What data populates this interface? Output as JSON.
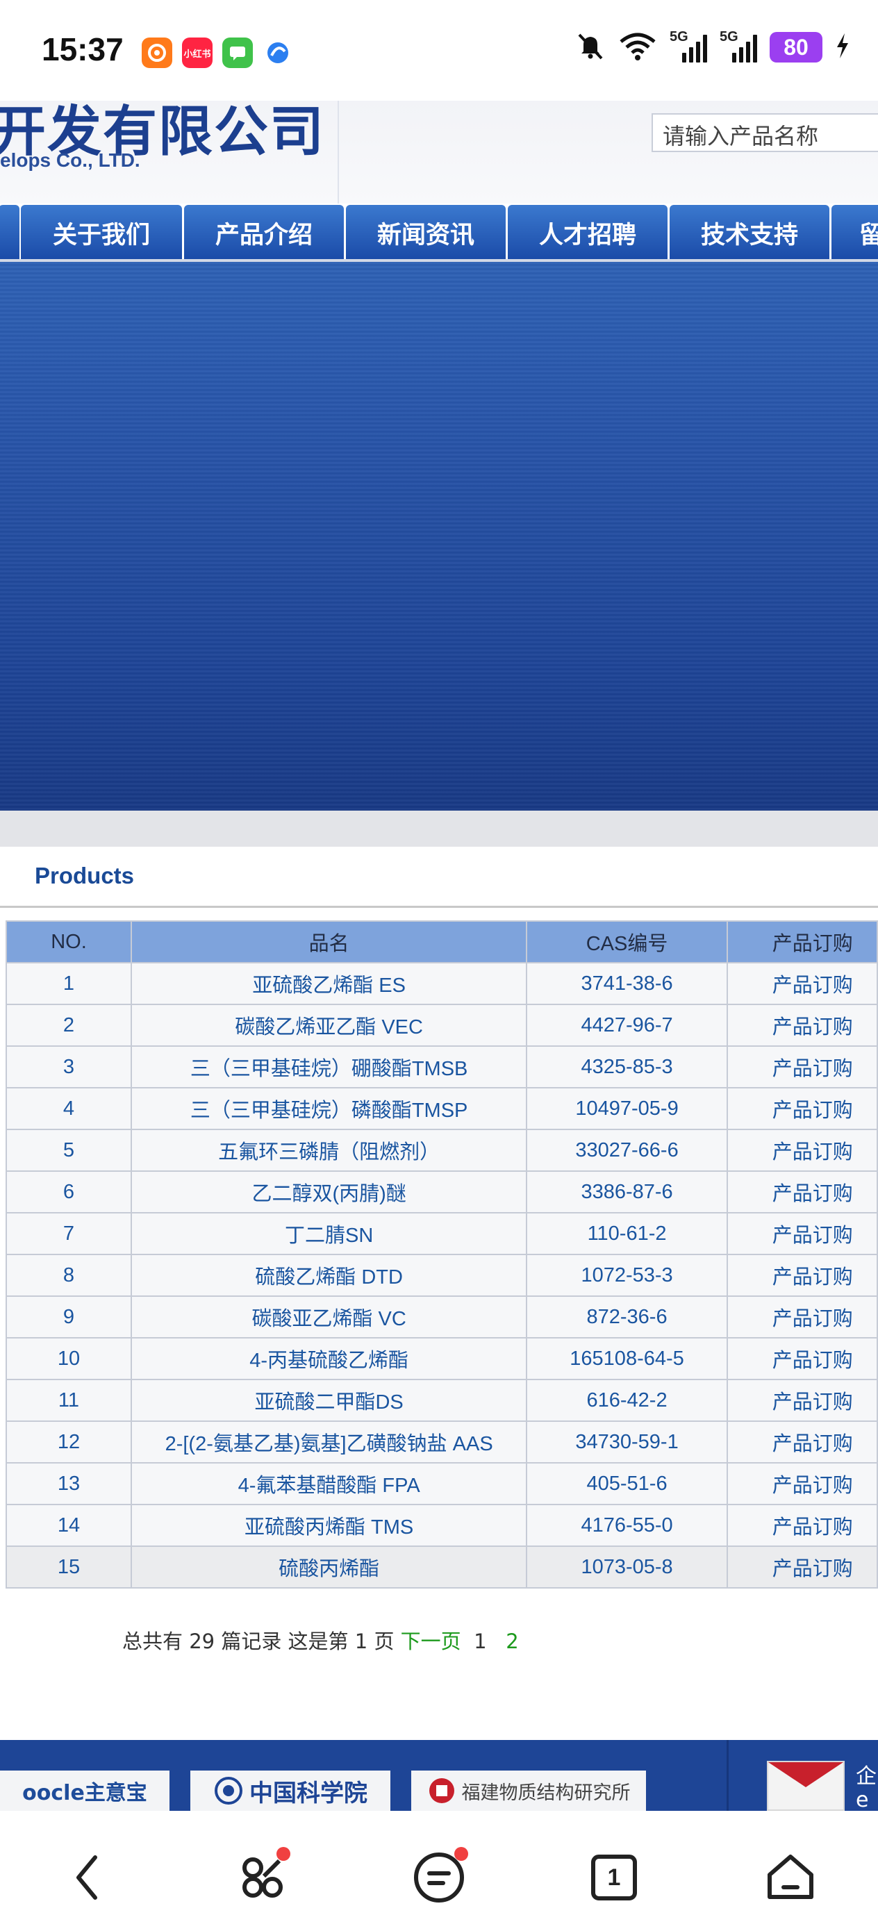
{
  "status_bar": {
    "time": "15:37",
    "apps": [
      {
        "icon": "taobao-app-icon",
        "label": "",
        "color": "#ff7a1a"
      },
      {
        "icon": "xiaohongshu-app-icon",
        "label": "小红书",
        "color": "#ff2442"
      },
      {
        "icon": "messages-app-icon",
        "label": "",
        "color": "#3fc24a"
      },
      {
        "icon": "browser-app-icon",
        "label": "",
        "color": "#2c7ff0"
      }
    ],
    "network_1": "5G",
    "network_2": "5G",
    "battery": "80"
  },
  "header": {
    "logo_cn": "开发有限公司",
    "logo_en": "elops Co., LTD.",
    "search_placeholder": "请输入产品名称"
  },
  "nav": {
    "items": [
      "关于我们",
      "产品介绍",
      "新闻资讯",
      "人才招聘",
      "技术支持",
      "留"
    ]
  },
  "products": {
    "title": "Products",
    "columns": [
      "NO.",
      "品名",
      "CAS编号",
      "产品订购"
    ],
    "rows": [
      {
        "no": "1",
        "name": "亚硫酸乙烯酯 ES",
        "cas": "3741-38-6",
        "order": "产品订购"
      },
      {
        "no": "2",
        "name": "碳酸乙烯亚乙酯 VEC",
        "cas": "4427-96-7",
        "order": "产品订购"
      },
      {
        "no": "3",
        "name": "三（三甲基硅烷）硼酸酯TMSB",
        "cas": "4325-85-3",
        "order": "产品订购"
      },
      {
        "no": "4",
        "name": "三（三甲基硅烷）磷酸酯TMSP",
        "cas": "10497-05-9",
        "order": "产品订购"
      },
      {
        "no": "5",
        "name": "五氟环三磷腈（阻燃剂）",
        "cas": "33027-66-6",
        "order": "产品订购"
      },
      {
        "no": "6",
        "name": "乙二醇双(丙腈)醚",
        "cas": "3386-87-6",
        "order": "产品订购"
      },
      {
        "no": "7",
        "name": "丁二腈SN",
        "cas": "110-61-2",
        "order": "产品订购"
      },
      {
        "no": "8",
        "name": "硫酸乙烯酯 DTD",
        "cas": "1072-53-3",
        "order": "产品订购"
      },
      {
        "no": "9",
        "name": "碳酸亚乙烯酯 VC",
        "cas": "872-36-6",
        "order": "产品订购"
      },
      {
        "no": "10",
        "name": "4-丙基硫酸乙烯酯",
        "cas": "165108-64-5",
        "order": "产品订购"
      },
      {
        "no": "11",
        "name": "亚硫酸二甲酯DS",
        "cas": "616-42-2",
        "order": "产品订购"
      },
      {
        "no": "12",
        "name": "2-[(2-氨基乙基)氨基]乙磺酸钠盐 AAS",
        "cas": "34730-59-1",
        "order": "产品订购"
      },
      {
        "no": "13",
        "name": "4-氟苯基醋酸酯 FPA",
        "cas": "405-51-6",
        "order": "产品订购"
      },
      {
        "no": "14",
        "name": "亚硫酸丙烯酯 TMS",
        "cas": "4176-55-0",
        "order": "产品订购"
      },
      {
        "no": "15",
        "name": "硫酸丙烯酯",
        "cas": "1073-05-8",
        "order": "产品订购"
      }
    ]
  },
  "pagination": {
    "summary": "总共有 29 篇记录 这是第 1 页",
    "next_label": "下一页",
    "pages": [
      "1",
      "2"
    ]
  },
  "footer": {
    "partner_1": "oocle主意宝",
    "partner_2": "中国科学院",
    "partner_3": "福建物质结构研究所",
    "side_text_1": "企",
    "side_text_2": "e"
  },
  "bottom_nav": {
    "tab_count": "1"
  }
}
